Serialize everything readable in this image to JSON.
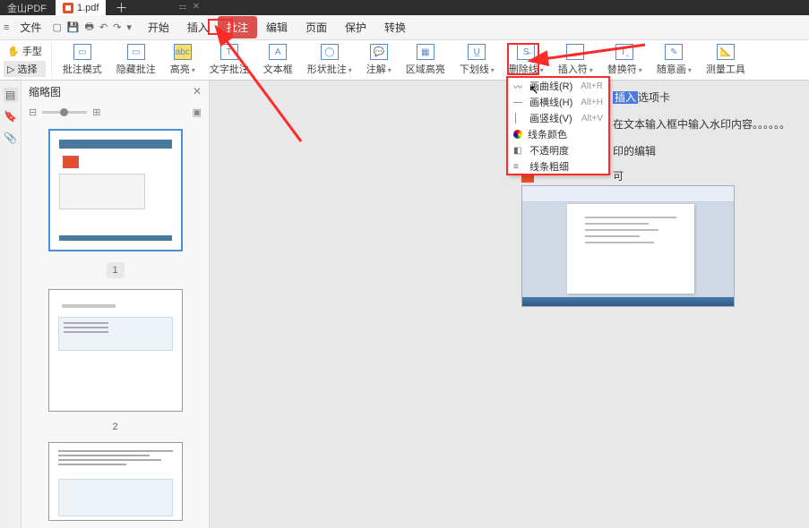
{
  "app": {
    "name": "金山PDF"
  },
  "tab": {
    "title": "1.pdf"
  },
  "menubar": {
    "file": "文件",
    "items": [
      "开始",
      "插入",
      "批注",
      "编辑",
      "页面",
      "保护",
      "转换"
    ],
    "active_index": 2
  },
  "tool_left": {
    "hand": "手型",
    "select": "选择"
  },
  "toolbar": {
    "items": [
      {
        "label": "批注模式",
        "icon": "annotate-mode"
      },
      {
        "label": "隐藏批注",
        "icon": "hide-annotate"
      },
      {
        "label": "高亮",
        "icon": "highlight",
        "dd": true
      },
      {
        "label": "文字批注",
        "icon": "text-annotate"
      },
      {
        "label": "文本框",
        "icon": "textbox"
      },
      {
        "label": "形状批注",
        "icon": "shape-annotate",
        "dd": true
      },
      {
        "label": "注解",
        "icon": "note",
        "dd": true
      },
      {
        "label": "区域高亮",
        "icon": "area-highlight"
      },
      {
        "label": "下划线",
        "icon": "underline",
        "dd": true
      },
      {
        "label": "删除线",
        "icon": "strikethrough",
        "dd": true
      },
      {
        "label": "插入符",
        "icon": "caret",
        "dd": true
      },
      {
        "label": "替换符",
        "icon": "replace",
        "dd": true
      },
      {
        "label": "随意画",
        "icon": "freedraw",
        "dd": true,
        "highlight": true
      },
      {
        "label": "测量工具",
        "icon": "measure"
      }
    ]
  },
  "thumbs": {
    "title": "缩略图",
    "pages": [
      "1",
      "2"
    ]
  },
  "dropdown": {
    "items": [
      {
        "icon": "curve",
        "label": "画曲线(R)",
        "shortcut": "Alt+R"
      },
      {
        "icon": "hline",
        "label": "画横线(H)",
        "shortcut": "Alt+H"
      },
      {
        "icon": "vline",
        "label": "画竖线(V)",
        "shortcut": "Alt+V"
      },
      {
        "icon": "rainbow",
        "label": "线条颜色",
        "shortcut": ""
      },
      {
        "icon": "opacity",
        "label": "不透明度",
        "shortcut": ""
      },
      {
        "icon": "weight",
        "label": "线条粗细",
        "shortcut": ""
      }
    ]
  },
  "floating": {
    "l1a": "插入",
    "l1b": "选项卡",
    "l2": "在文本输入框中输入水印内容。。。。。。",
    "l3": "印的编辑",
    "l4": "可"
  }
}
